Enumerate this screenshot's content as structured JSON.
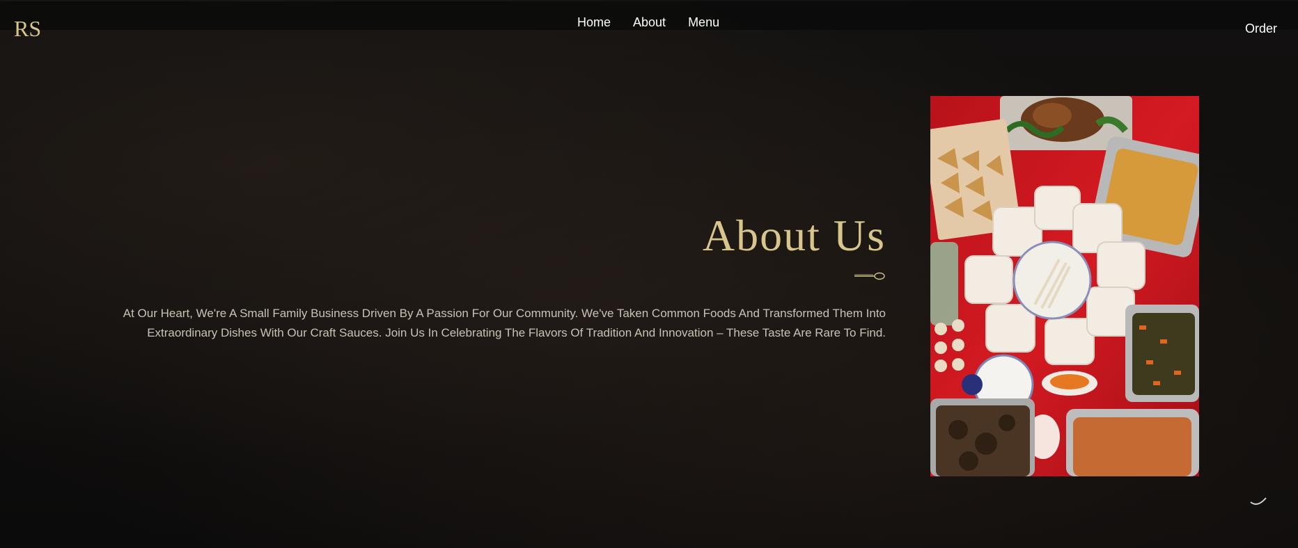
{
  "brand": {
    "logo_text": "RS"
  },
  "nav": {
    "items": [
      {
        "label": "Home"
      },
      {
        "label": "About"
      },
      {
        "label": "Menu"
      }
    ],
    "order_label": "Order"
  },
  "about": {
    "heading": "About Us",
    "lines": [
      "At Our Heart, We're A Small Family Business Driven By A Passion For Our Community. We've Taken Common Foods And Transformed Them Into",
      "Extraordinary Dishes With Our Craft Sauces. Join Us In Celebrating The Flavors Of Tradition And Innovation – These Taste Are Rare To Find."
    ]
  },
  "photo": {
    "icon": "food-spread-photo"
  },
  "colors": {
    "accent_gold": "#d7c58b",
    "background": "#0d0c0c",
    "tablecloth_red": "#c8141b"
  }
}
